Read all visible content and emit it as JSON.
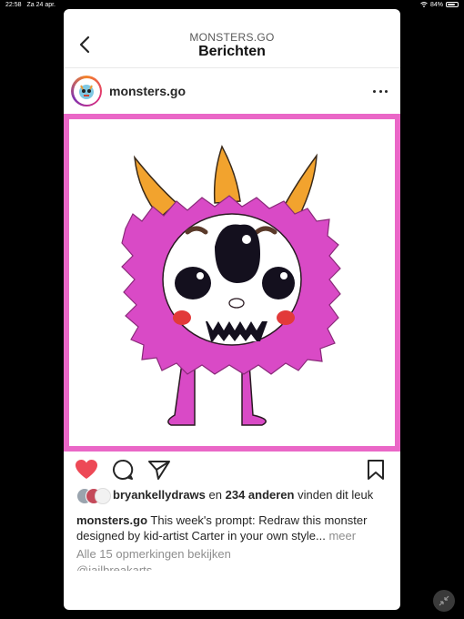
{
  "status_bar": {
    "time": "22:58",
    "date": "Za 24 apr.",
    "battery": "84%",
    "battery_level": 0.84
  },
  "nav": {
    "subtitle": "MONSTERS.GO",
    "title": "Berichten"
  },
  "post": {
    "username": "monsters.go",
    "liked": true,
    "likes": {
      "first_user": "bryankellydraws",
      "connector": "en",
      "others": "234 anderen",
      "suffix": "vinden dit leuk"
    },
    "caption": {
      "username": "monsters.go",
      "text": "This week's prompt:  Redraw this monster designed by kid-artist Carter in your own style...",
      "more": "meer"
    },
    "view_comments": "Alle 15 opmerkingen bekijken",
    "next_comment": "@jailbreakarts"
  },
  "colors": {
    "accent_pink": "#ea67c7",
    "like_red": "#ed4956",
    "text": "#262626",
    "muted": "#8e8e8e"
  }
}
